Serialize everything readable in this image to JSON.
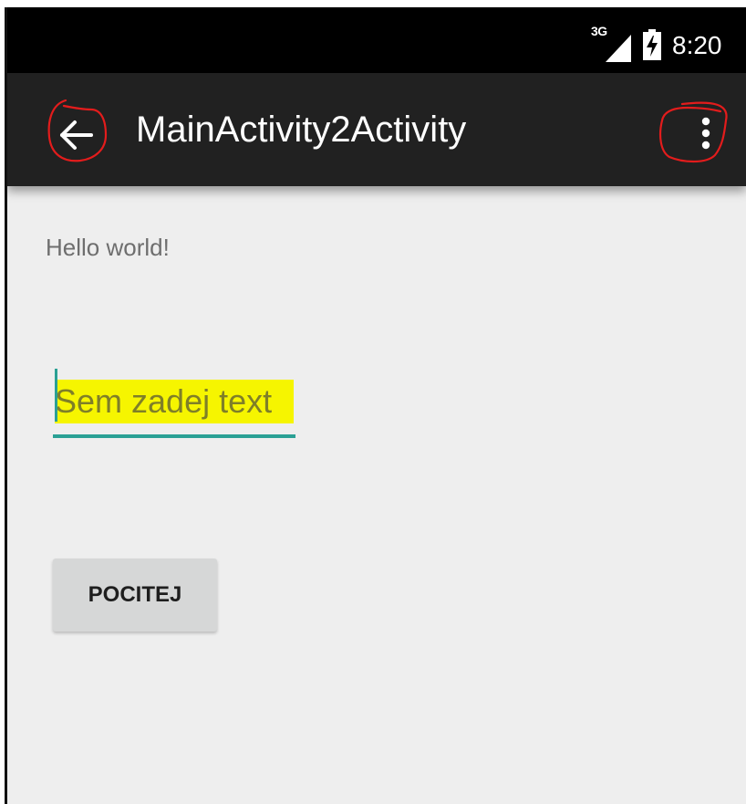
{
  "status_bar": {
    "network": "3G",
    "time": "8:20",
    "icons": [
      "signal-icon",
      "battery-charging-icon"
    ]
  },
  "toolbar": {
    "title": "MainActivity2Activity",
    "back_icon": "arrow-back-icon",
    "overflow_icon": "more-vert-icon",
    "background_color": "#212121"
  },
  "content": {
    "hello_text": "Hello world!",
    "edit_text": {
      "placeholder": "Sem zadej text",
      "value": "",
      "accent_color": "#2aa094",
      "highlight_color": "#f6f500"
    },
    "button_label": "POCITEJ"
  },
  "annotations": {
    "marker_color": "#e31c1c"
  }
}
